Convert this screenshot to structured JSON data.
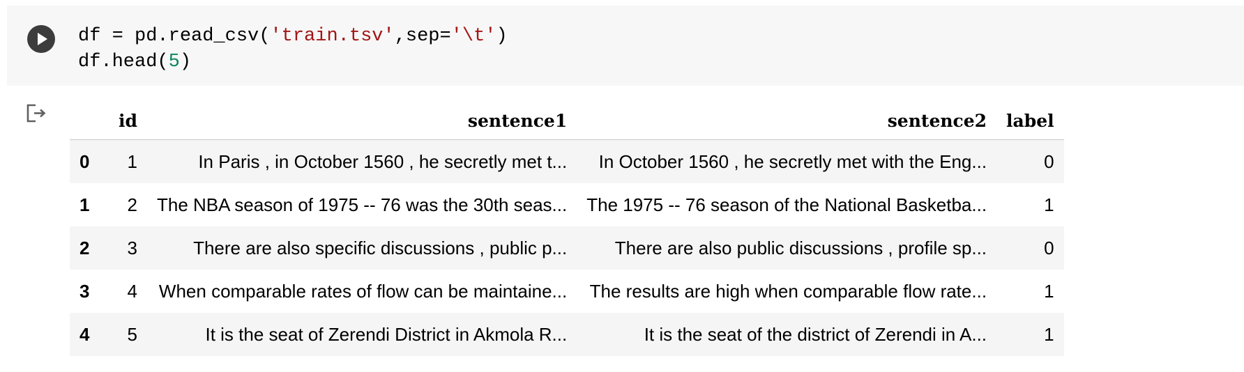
{
  "code_cell": {
    "line1": {
      "prefix": "df = pd.read_csv(",
      "filename": "'train.tsv'",
      "mid": ",sep=",
      "separator": "'\\t'",
      "suffix": ")"
    },
    "line2": {
      "prefix": "df.head(",
      "number": "5",
      "suffix": ")"
    },
    "run_icon": "play-icon"
  },
  "output": {
    "icon": "output-redirect-icon",
    "columns": [
      "",
      "id",
      "sentence1",
      "sentence2",
      "label"
    ],
    "rows": [
      {
        "index": "0",
        "id": "1",
        "sentence1": "In Paris , in October 1560 , he secretly met t...",
        "sentence2": "In October 1560 , he secretly met with the Eng...",
        "label": "0"
      },
      {
        "index": "1",
        "id": "2",
        "sentence1": "The NBA season of 1975 -- 76 was the 30th seas...",
        "sentence2": "The 1975 -- 76 season of the National Basketba...",
        "label": "1"
      },
      {
        "index": "2",
        "id": "3",
        "sentence1": "There are also specific discussions , public p...",
        "sentence2": "There are also public discussions , profile sp...",
        "label": "0"
      },
      {
        "index": "3",
        "id": "4",
        "sentence1": "When comparable rates of flow can be maintaine...",
        "sentence2": "The results are high when comparable flow rate...",
        "label": "1"
      },
      {
        "index": "4",
        "id": "5",
        "sentence1": "It is the seat of Zerendi District in Akmola R...",
        "sentence2": "It is the seat of the district of Zerendi in A...",
        "label": "1"
      }
    ]
  }
}
